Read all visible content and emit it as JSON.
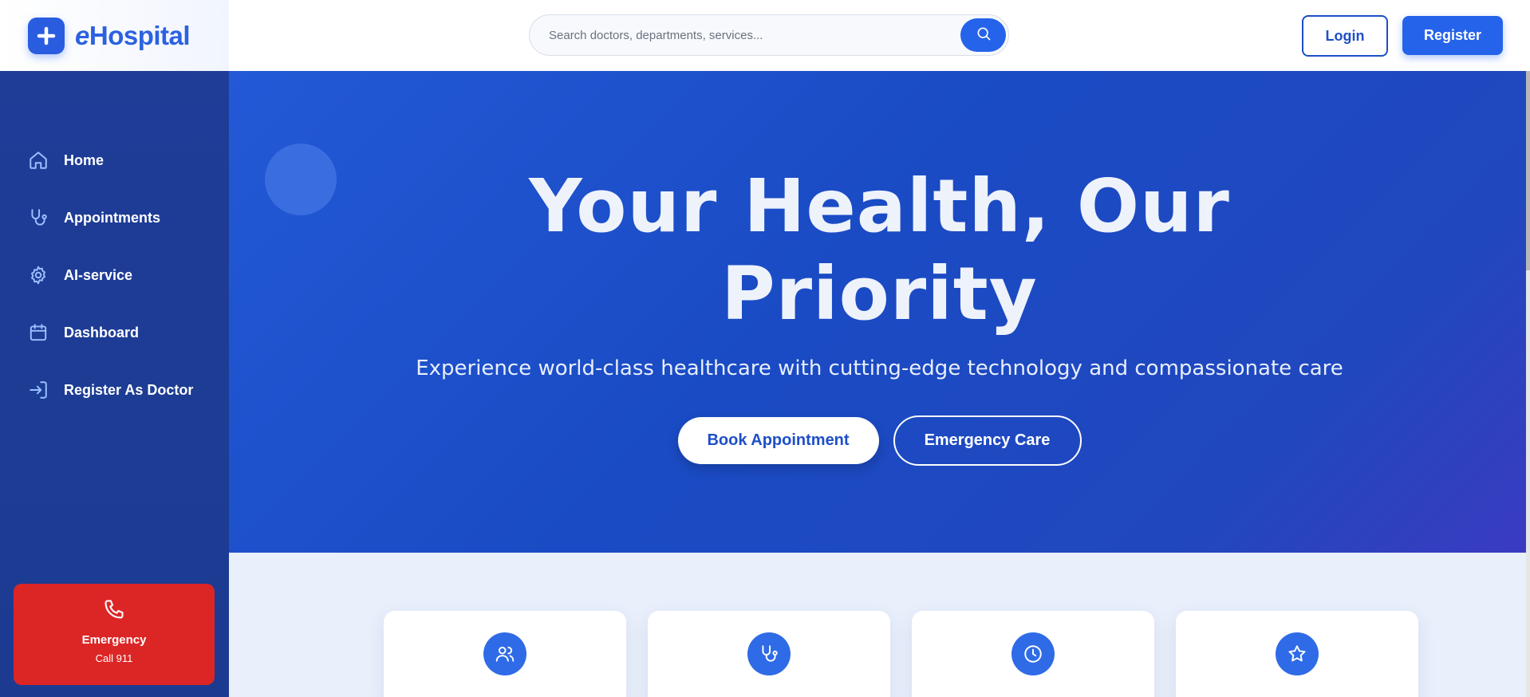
{
  "brand": {
    "prefix": "e",
    "name": "Hospital",
    "logo_icon": "plus-icon"
  },
  "search": {
    "placeholder": "Search doctors, departments, services...",
    "icon": "search-icon"
  },
  "auth": {
    "login_label": "Login",
    "register_label": "Register"
  },
  "sidebar": {
    "items": [
      {
        "label": "Home",
        "icon": "home-icon"
      },
      {
        "label": "Appointments",
        "icon": "stethoscope-icon"
      },
      {
        "label": "AI-service",
        "icon": "gear-icon"
      },
      {
        "label": "Dashboard",
        "icon": "calendar-icon"
      },
      {
        "label": "Register As Doctor",
        "icon": "login-icon"
      }
    ],
    "emergency": {
      "title": "Emergency",
      "subtitle": "Call 911",
      "icon": "phone-icon"
    }
  },
  "hero": {
    "title_line1": "Your Health, Our",
    "title_line2": "Priority",
    "subtitle": "Experience world-class healthcare with cutting-edge technology and compassionate care",
    "primary_cta": "Book Appointment",
    "secondary_cta": "Emergency Care"
  },
  "features": [
    {
      "icon": "users-icon"
    },
    {
      "icon": "stethoscope-icon"
    },
    {
      "icon": "clock-icon"
    },
    {
      "icon": "star-icon"
    }
  ],
  "colors": {
    "primary": "#2563eb",
    "sidebar": "#1f3d98",
    "emergency": "#dc2626",
    "hero_text": "#eef2fb"
  }
}
